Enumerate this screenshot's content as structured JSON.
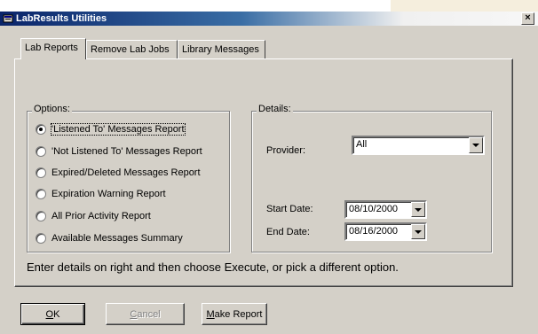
{
  "window": {
    "title": "LabResults Utilities",
    "close_label": "×"
  },
  "tabs": [
    {
      "label": "Lab Reports",
      "active": true
    },
    {
      "label": "Remove Lab Jobs",
      "active": false
    },
    {
      "label": "Library Messages",
      "active": false
    }
  ],
  "options": {
    "legend": "Options:",
    "items": [
      {
        "label": "'Listened To' Messages Report",
        "checked": true
      },
      {
        "label": "'Not Listened To' Messages Report",
        "checked": false
      },
      {
        "label": "Expired/Deleted Messages Report",
        "checked": false
      },
      {
        "label": "Expiration Warning Report",
        "checked": false
      },
      {
        "label": "All Prior Activity Report",
        "checked": false
      },
      {
        "label": "Available Messages Summary",
        "checked": false
      }
    ]
  },
  "details": {
    "legend": "Details:",
    "provider_label": "Provider:",
    "provider_value": "All",
    "start_date_label": "Start Date:",
    "start_date_value": "08/10/2000",
    "end_date_label": "End Date:",
    "end_date_value": "08/16/2000"
  },
  "instruction": "Enter details on right and then choose Execute, or pick a different option.",
  "buttons": {
    "ok_mnemonic": "O",
    "ok_rest": "K",
    "cancel_mnemonic": "C",
    "cancel_rest": "ancel",
    "make_report_mnemonic": "M",
    "make_report_rest": "ake Report"
  },
  "colors": {
    "title_start": "#0a246a",
    "title_end": "#f0f0f0",
    "face": "#d4d0c8"
  }
}
